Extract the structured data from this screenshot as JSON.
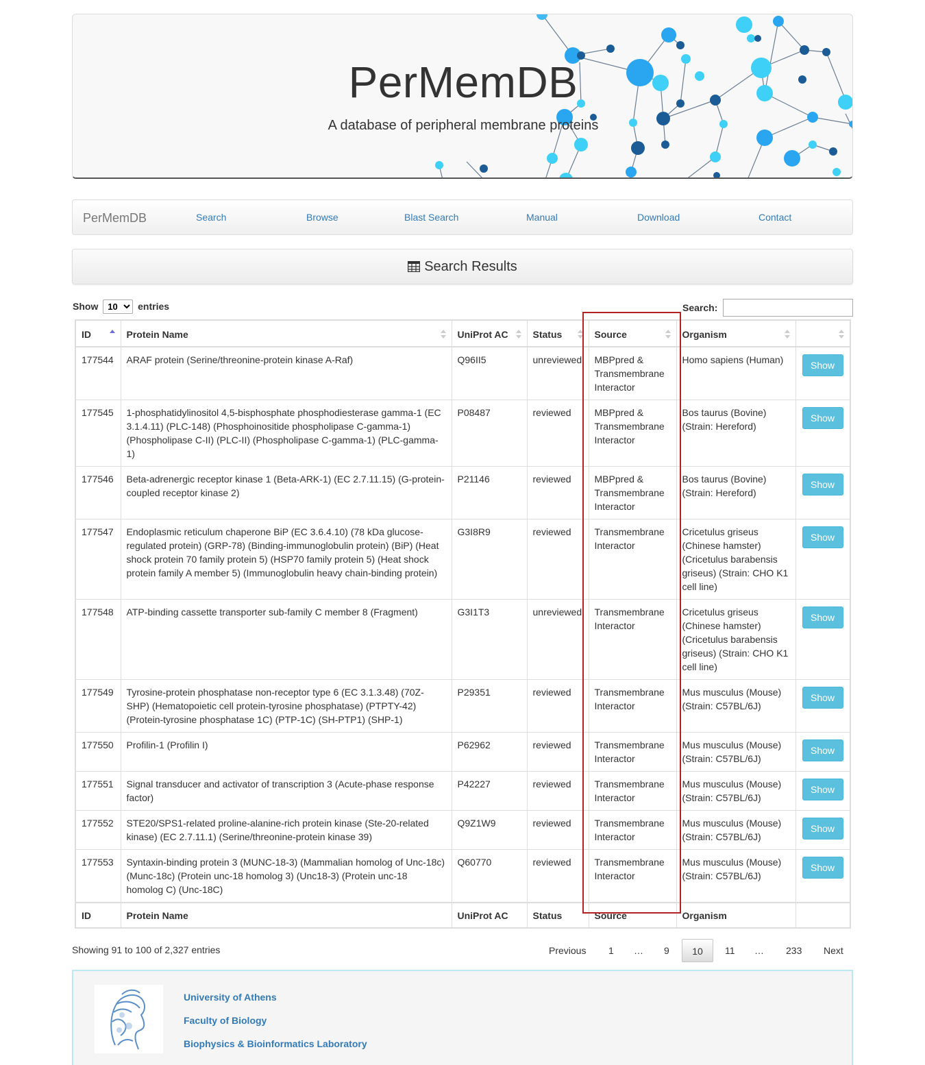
{
  "banner": {
    "title": "PerMemDB",
    "subtitle": "A database of peripheral membrane proteins"
  },
  "navbar": {
    "brand": "PerMemDB",
    "links": [
      "Search",
      "Browse",
      "Blast Search",
      "Manual",
      "Download",
      "Contact"
    ]
  },
  "panel": {
    "title": "Search Results",
    "icon": "table-icon"
  },
  "controls": {
    "show_label": "Show",
    "entries_label": "entries",
    "page_length": "10",
    "search_label": "Search:",
    "search_value": ""
  },
  "table": {
    "columns": [
      "ID",
      "Protein Name",
      "UniProt AC",
      "Status",
      "Source",
      "Organism",
      ""
    ],
    "button_label": "Show",
    "rows": [
      {
        "id": "177544",
        "name": "ARAF protein (Serine/threonine-protein kinase A-Raf)",
        "ac": "Q96II5",
        "status": "unreviewed",
        "source": "MBPpred & Transmembrane Interactor",
        "organism": "Homo sapiens (Human)"
      },
      {
        "id": "177545",
        "name": "1-phosphatidylinositol 4,5-bisphosphate phosphodiesterase gamma-1 (EC 3.1.4.11) (PLC-148) (Phosphoinositide phospholipase C-gamma-1) (Phospholipase C-II) (PLC-II) (Phospholipase C-gamma-1) (PLC-gamma-1)",
        "ac": "P08487",
        "status": "reviewed",
        "source": "MBPpred & Transmembrane Interactor",
        "organism": "Bos taurus (Bovine) (Strain: Hereford)"
      },
      {
        "id": "177546",
        "name": "Beta-adrenergic receptor kinase 1 (Beta-ARK-1) (EC 2.7.11.15) (G-protein-coupled receptor kinase 2)",
        "ac": "P21146",
        "status": "reviewed",
        "source": "MBPpred & Transmembrane Interactor",
        "organism": "Bos taurus (Bovine) (Strain: Hereford)"
      },
      {
        "id": "177547",
        "name": "Endoplasmic reticulum chaperone BiP (EC 3.6.4.10) (78 kDa glucose-regulated protein) (GRP-78) (Binding-immunoglobulin protein) (BiP) (Heat shock protein 70 family protein 5) (HSP70 family protein 5) (Heat shock protein family A member 5) (Immunoglobulin heavy chain-binding protein)",
        "ac": "G3I8R9",
        "status": "reviewed",
        "source": "Transmembrane Interactor",
        "organism": "Cricetulus griseus (Chinese hamster) (Cricetulus barabensis griseus) (Strain: CHO K1 cell line)"
      },
      {
        "id": "177548",
        "name": "ATP-binding cassette transporter sub-family C member 8 (Fragment)",
        "ac": "G3I1T3",
        "status": "unreviewed",
        "source": "Transmembrane Interactor",
        "organism": "Cricetulus griseus (Chinese hamster) (Cricetulus barabensis griseus) (Strain: CHO K1 cell line)"
      },
      {
        "id": "177549",
        "name": "Tyrosine-protein phosphatase non-receptor type 6 (EC 3.1.3.48) (70Z-SHP) (Hematopoietic cell protein-tyrosine phosphatase) (PTPTY-42) (Protein-tyrosine phosphatase 1C) (PTP-1C) (SH-PTP1) (SHP-1)",
        "ac": "P29351",
        "status": "reviewed",
        "source": "Transmembrane Interactor",
        "organism": "Mus musculus (Mouse) (Strain: C57BL/6J)"
      },
      {
        "id": "177550",
        "name": "Profilin-1 (Profilin I)",
        "ac": "P62962",
        "status": "reviewed",
        "source": "Transmembrane Interactor",
        "organism": "Mus musculus (Mouse) (Strain: C57BL/6J)"
      },
      {
        "id": "177551",
        "name": "Signal transducer and activator of transcription 3 (Acute-phase response factor)",
        "ac": "P42227",
        "status": "reviewed",
        "source": "Transmembrane Interactor",
        "organism": "Mus musculus (Mouse) (Strain: C57BL/6J)"
      },
      {
        "id": "177552",
        "name": "STE20/SPS1-related proline-alanine-rich protein kinase (Ste-20-related kinase) (EC 2.7.11.1) (Serine/threonine-protein kinase 39)",
        "ac": "Q9Z1W9",
        "status": "reviewed",
        "source": "Transmembrane Interactor",
        "organism": "Mus musculus (Mouse) (Strain: C57BL/6J)"
      },
      {
        "id": "177553",
        "name": "Syntaxin-binding protein 3 (MUNC-18-3) (Mammalian homolog of Unc-18c) (Munc-18c) (Protein unc-18 homolog 3) (Unc18-3) (Protein unc-18 homolog C) (Unc-18C)",
        "ac": "Q60770",
        "status": "reviewed",
        "source": "Transmembrane Interactor",
        "organism": "Mus musculus (Mouse) (Strain: C57BL/6J)"
      }
    ]
  },
  "info": "Showing 91 to 100 of 2,327 entries",
  "pagination": {
    "previous": "Previous",
    "pages": [
      "1",
      "…",
      "9",
      "10",
      "11",
      "…",
      "233"
    ],
    "current": "10",
    "next": "Next"
  },
  "footer": {
    "links": [
      "University of Athens",
      "Faculty of Biology",
      "Biophysics & Bioinformatics Laboratory"
    ],
    "logo": "athena-head-logo"
  },
  "colors": {
    "link": "#337ab7",
    "button": "#5bc0de",
    "highlight": "#b22222",
    "footer_border": "#bce8f1"
  }
}
